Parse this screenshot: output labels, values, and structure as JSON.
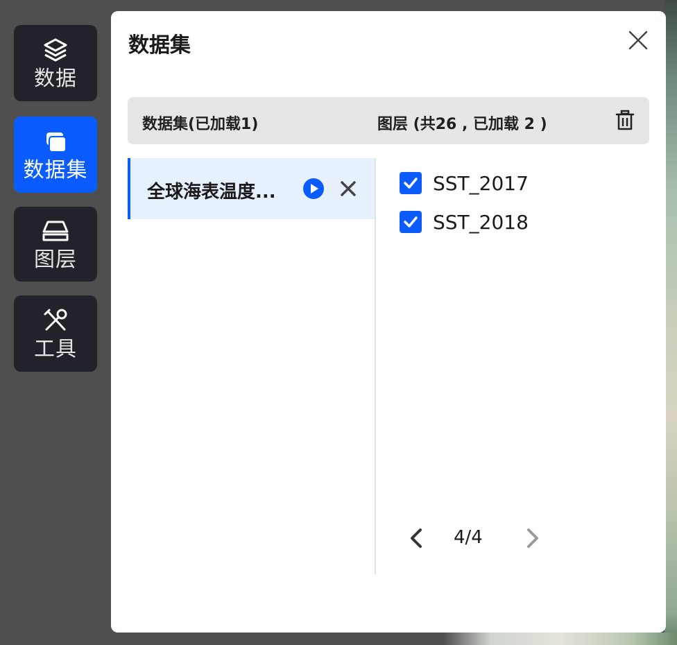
{
  "nav": [
    {
      "label": "数据",
      "icon": "layers-icon",
      "active": false
    },
    {
      "label": "数据集",
      "icon": "cards-icon",
      "active": true
    },
    {
      "label": "图层",
      "icon": "layer-stack-icon",
      "active": false
    },
    {
      "label": "工具",
      "icon": "tools-icon",
      "active": false
    }
  ],
  "panel": {
    "title": "数据集",
    "header": {
      "datasets_label": "数据集(已加载1)",
      "layers_label": "图层 (共26 , 已加载 2 )"
    },
    "datasets": [
      {
        "name": "全球海表温度..."
      }
    ],
    "layers": [
      {
        "name": "SST_2017",
        "checked": true
      },
      {
        "name": "SST_2018",
        "checked": true
      }
    ],
    "pagination": {
      "current": "4/4"
    }
  },
  "colors": {
    "accent": "#0b5cff",
    "selected_bg": "#e6f1fd",
    "nav_bg": "#22232a"
  }
}
